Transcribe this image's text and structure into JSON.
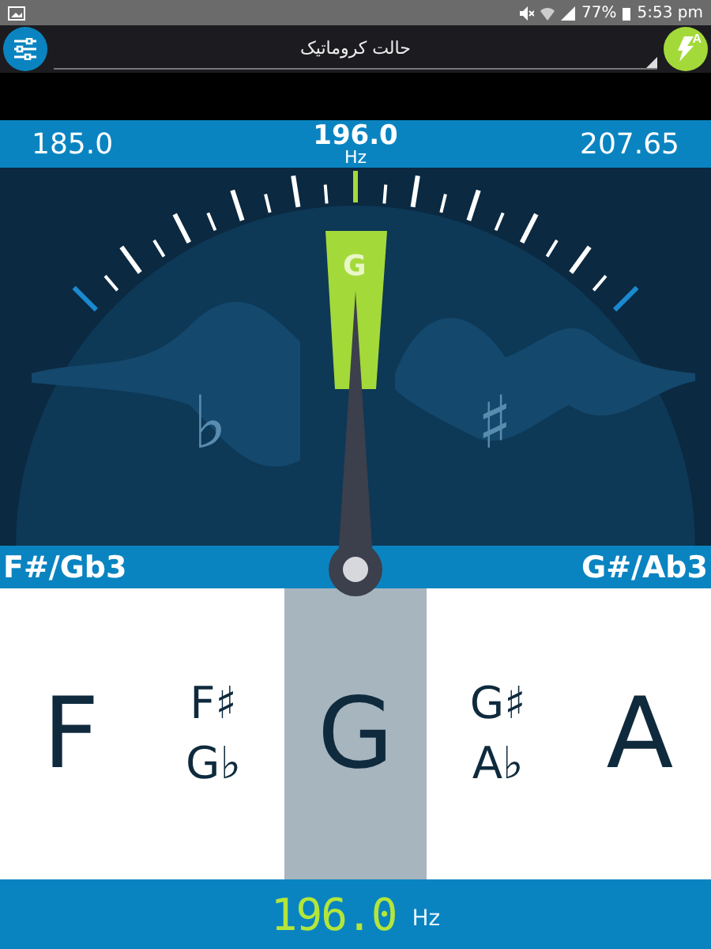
{
  "status_bar": {
    "battery": "77%",
    "time": "5:53 pm"
  },
  "app_bar": {
    "mode": "حالت کروماتیک",
    "auto_badge": "A"
  },
  "frequency_bar": {
    "low": "185.0",
    "current": "196.0",
    "unit": "Hz",
    "high": "207.65"
  },
  "gauge": {
    "note": "G",
    "flat": "♭",
    "sharp": "♯"
  },
  "neighbor_bar": {
    "previous": "F#/Gb3",
    "next": "G#/Ab3"
  },
  "notes": [
    {
      "labels": [
        "F"
      ],
      "selected": false
    },
    {
      "labels": [
        "F♯",
        "G♭"
      ],
      "selected": false
    },
    {
      "labels": [
        "G"
      ],
      "selected": true
    },
    {
      "labels": [
        "G♯",
        "A♭"
      ],
      "selected": false
    },
    {
      "labels": [
        "A"
      ],
      "selected": false
    }
  ],
  "reading": {
    "value": "196.0",
    "unit": "Hz"
  }
}
